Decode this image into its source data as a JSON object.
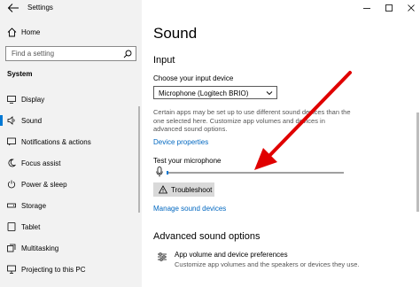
{
  "window": {
    "title": "Settings"
  },
  "sidebar": {
    "home_label": "Home",
    "search_placeholder": "Find a setting",
    "section": "System",
    "items": [
      {
        "label": "Display",
        "icon": "display-icon"
      },
      {
        "label": "Sound",
        "icon": "speaker-icon",
        "active": true
      },
      {
        "label": "Notifications & actions",
        "icon": "notifications-icon"
      },
      {
        "label": "Focus assist",
        "icon": "moon-icon"
      },
      {
        "label": "Power & sleep",
        "icon": "power-icon"
      },
      {
        "label": "Storage",
        "icon": "storage-icon"
      },
      {
        "label": "Tablet",
        "icon": "tablet-icon"
      },
      {
        "label": "Multitasking",
        "icon": "multitasking-icon"
      },
      {
        "label": "Projecting to this PC",
        "icon": "projecting-icon"
      }
    ]
  },
  "main": {
    "title": "Sound",
    "input_heading": "Input",
    "choose_label": "Choose your input device",
    "device_selected": "Microphone (Logitech BRIO)",
    "description": "Certain apps may be set up to use different sound devices than the one selected here. Customize app volumes and devices in advanced sound options.",
    "device_properties_link": "Device properties",
    "test_label": "Test your microphone",
    "mic_level": 0.01,
    "troubleshoot_label": "Troubleshoot",
    "manage_link": "Manage sound devices",
    "advanced_heading": "Advanced sound options",
    "app_volume_title": "App volume and device preferences",
    "app_volume_desc": "Customize app volumes and the speakers or devices they use."
  },
  "colors": {
    "accent": "#0078d4",
    "link": "#0067c0",
    "arrow": "#e00000",
    "sidebar_bg": "#f2f2f2"
  }
}
